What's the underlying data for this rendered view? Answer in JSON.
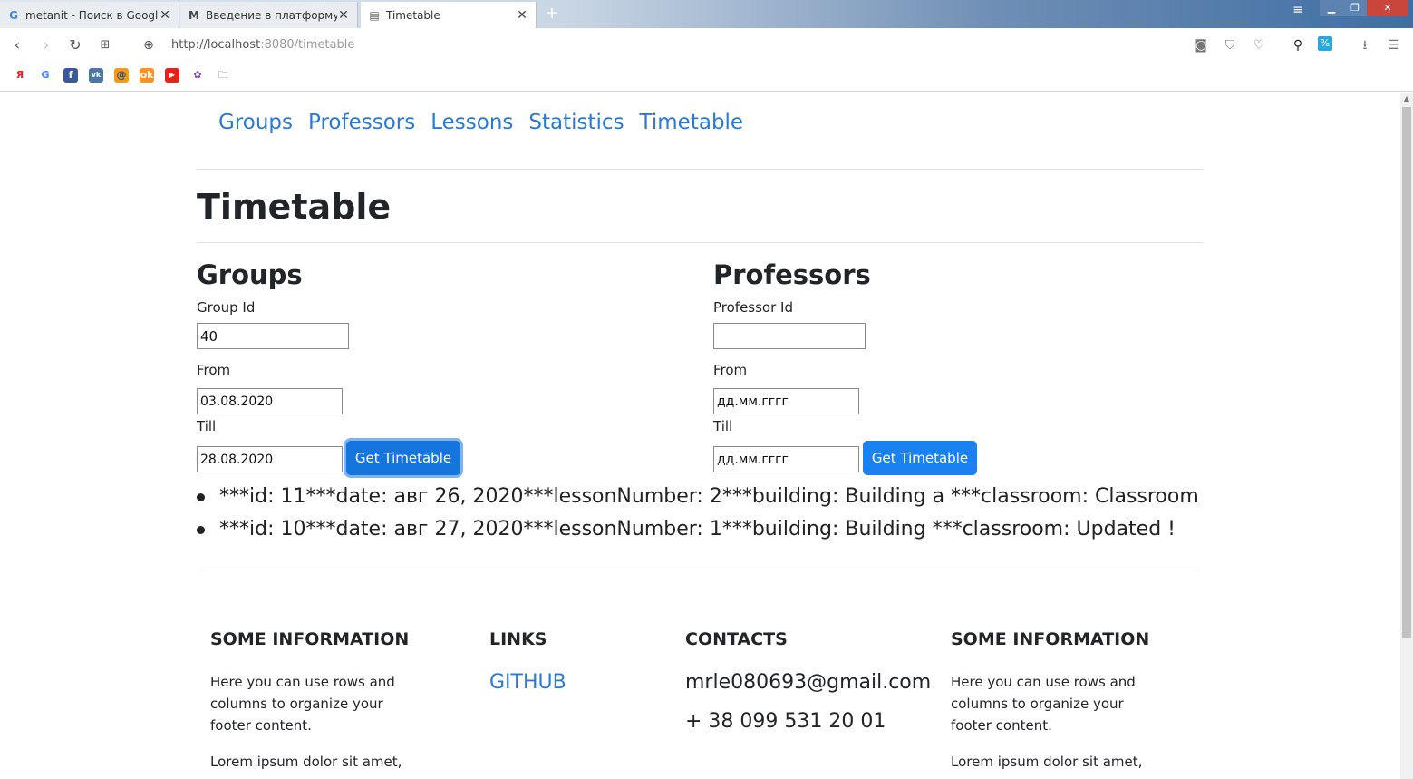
{
  "browser": {
    "tabs": [
      {
        "label": "metanit - Поиск в Google",
        "icon": "google-icon"
      },
      {
        "label": "Введение в платформу Ar",
        "icon": "m-icon"
      },
      {
        "label": "Timetable",
        "icon": "document-icon"
      }
    ],
    "url_host": "http://localhost",
    "url_rest": ":8080/timetable"
  },
  "nav": {
    "groups": "Groups",
    "professors": "Professors",
    "lessons": "Lessons",
    "statistics": "Statistics",
    "timetable": "Timetable"
  },
  "page_title": "Timetable",
  "groups": {
    "heading": "Groups",
    "id_label": "Group Id",
    "id_value": "40",
    "from_label": "From",
    "from_value": "03.08.2020",
    "till_label": "Till",
    "till_value": "28.08.2020",
    "button": "Get Timetable"
  },
  "professors": {
    "heading": "Professors",
    "id_label": "Professor Id",
    "id_value": "",
    "from_label": "From",
    "from_value": "дд.мм.гггг",
    "till_label": "Till",
    "till_value": "дд.мм.гггг",
    "button": "Get Timetable"
  },
  "results": [
    "***id: 11***date: авг 26, 2020***lessonNumber: 2***building: Building a ***classroom: Classroom",
    "***id: 10***date: авг 27, 2020***lessonNumber: 1***building: Building ***classroom: Updated !"
  ],
  "footer": {
    "info1_title": "SOME INFORMATION",
    "info1_text": "Here you can use rows and columns to organize your footer content.",
    "info1_lorem": "Lorem ipsum dolor sit amet,",
    "links_title": "LINKS",
    "github": "GITHUB",
    "contacts_title": "CONTACTS",
    "email": "mrle080693@gmail.com",
    "phone": "+ 38 099 531 20 01",
    "info2_title": "SOME INFORMATION",
    "info2_text": "Here you can use rows and columns to organize your footer content.",
    "info2_lorem": "Lorem ipsum dolor sit amet,"
  },
  "colors": {
    "link": "#2a7ad5",
    "button": "#1a82f0"
  }
}
